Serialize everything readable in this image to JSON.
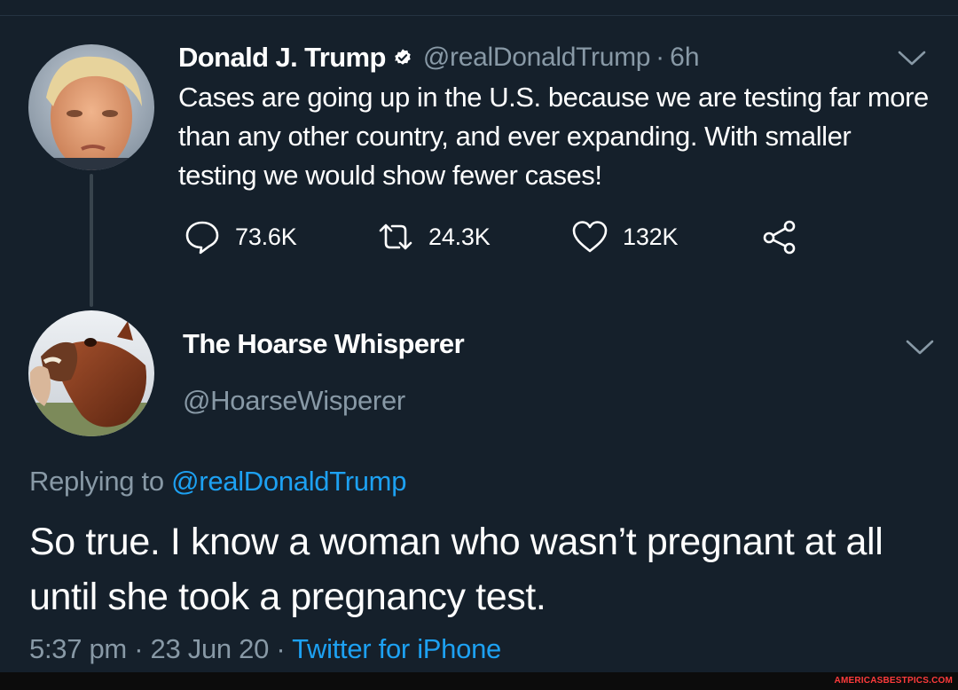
{
  "tweet1": {
    "display_name": "Donald J. Trump",
    "handle": "@realDonaldTrump",
    "separator": "·",
    "time": "6h",
    "text": "Cases are going up in the U.S. because we are testing far more than any other country, and ever expanding. With smaller testing we would show fewer cases!",
    "replies": "73.6K",
    "retweets": "24.3K",
    "likes": "132K",
    "icons": [
      "verified-icon",
      "chevron-down-icon",
      "reply-icon",
      "retweet-icon",
      "like-icon",
      "share-icon"
    ]
  },
  "tweet2": {
    "display_name": "The Hoarse Whisperer",
    "handle": "@HoarseWisperer",
    "replying_prefix": "Replying to",
    "replying_to": "@realDonaldTrump",
    "text": "So true. I know a woman who wasn’t pregnant at all until she took a pregnancy test.",
    "timestamp": "5:37 pm · 23 Jun 20 · ",
    "source": "Twitter for iPhone"
  },
  "watermark": "AMERICASBESTPICS.COM",
  "colors": {
    "background": "#15202b",
    "text_primary": "#ffffff",
    "text_secondary": "#8899a6",
    "link": "#1da1f2",
    "verified": "#ffffff"
  }
}
